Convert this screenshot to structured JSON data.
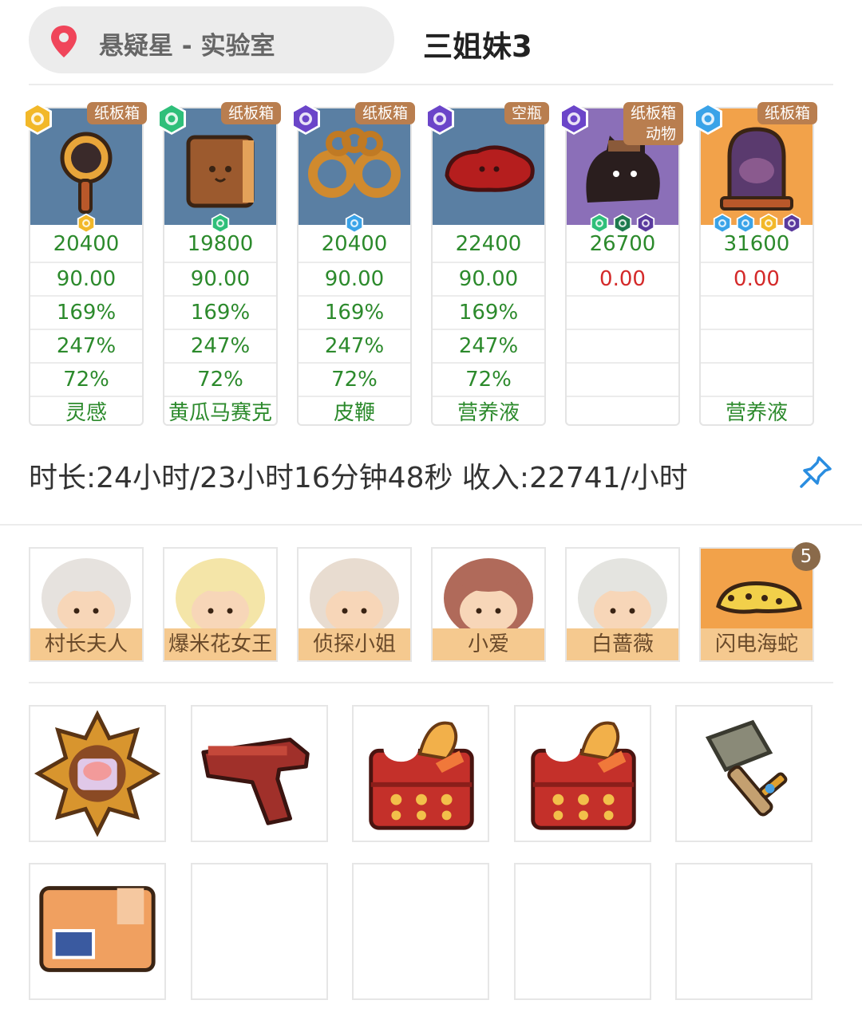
{
  "header": {
    "location": "悬疑星 - 实验室",
    "title": "三姐妹3",
    "pin_icon": "location-pin-icon"
  },
  "machines": [
    {
      "tag": "纸板箱",
      "rarity": "gold",
      "card_color": "#5a7fa3",
      "gems": [
        "gold"
      ],
      "values": [
        "20400",
        "90.00",
        "169%",
        "247%",
        "72%",
        "灵感"
      ],
      "item_icon": "magnifier-icon"
    },
    {
      "tag": "纸板箱",
      "rarity": "green",
      "card_color": "#5a7fa3",
      "gems": [
        "green"
      ],
      "values": [
        "19800",
        "90.00",
        "169%",
        "247%",
        "72%",
        "黄瓜马赛克"
      ],
      "item_icon": "book-icon"
    },
    {
      "tag": "纸板箱",
      "rarity": "purple",
      "card_color": "#5a7fa3",
      "gems": [
        "blue"
      ],
      "values": [
        "20400",
        "90.00",
        "169%",
        "247%",
        "72%",
        "皮鞭"
      ],
      "item_icon": "handcuffs-icon"
    },
    {
      "tag": "空瓶",
      "rarity": "purple",
      "card_color": "#5a7fa3",
      "gems": [],
      "values": [
        "22400",
        "90.00",
        "169%",
        "247%",
        "72%",
        "营养液"
      ],
      "item_icon": "red-jelly-icon"
    },
    {
      "tag": "纸板箱",
      "tag2": "动物",
      "rarity": "purple",
      "card_color": "#8b6fb8",
      "gems": [
        "green",
        "darkgreen",
        "purple"
      ],
      "values": [
        "26700",
        "0.00",
        "",
        "",
        "",
        ""
      ],
      "item_icon": "black-cat-icon"
    },
    {
      "tag": "纸板箱",
      "rarity": "blue",
      "card_color": "#f2a24a",
      "gems": [
        "blue",
        "blue",
        "gold",
        "purple"
      ],
      "values": [
        "31600",
        "0.00",
        "",
        "",
        "",
        "营养液"
      ],
      "item_icon": "bell-jar-icon"
    }
  ],
  "summary": {
    "text": "时长:24小时/23小时16分钟48秒 收入:22741/小时",
    "pin_icon": "pushpin-icon"
  },
  "residents": [
    {
      "name": "村长夫人",
      "icon": "village-chief-wife-avatar"
    },
    {
      "name": "爆米花女王",
      "icon": "popcorn-queen-avatar"
    },
    {
      "name": "侦探小姐",
      "icon": "detective-miss-avatar"
    },
    {
      "name": "小爱",
      "icon": "xiaoai-avatar"
    },
    {
      "name": "白蔷薇",
      "icon": "white-rose-avatar"
    },
    {
      "name": "闪电海蛇",
      "icon": "lightning-sea-snake-icon",
      "count": "5"
    }
  ],
  "items": [
    {
      "icon": "medal-icon"
    },
    {
      "icon": "pistol-icon"
    },
    {
      "icon": "bento-box-icon"
    },
    {
      "icon": "bento-box-icon"
    },
    {
      "icon": "hammer-sword-icon"
    },
    {
      "icon": "cardboard-box-icon"
    },
    {
      "icon": "empty-slot"
    },
    {
      "icon": "empty-slot"
    },
    {
      "icon": "empty-slot"
    },
    {
      "icon": "empty-slot"
    }
  ],
  "colors": {
    "value_green": "#2c8a2c",
    "value_red": "#d42a2a",
    "tag_brown": "#b97e4f",
    "name_bar": "#f5c98f",
    "pin_red": "#f0455a",
    "pushpin_blue": "#2a8de0"
  }
}
